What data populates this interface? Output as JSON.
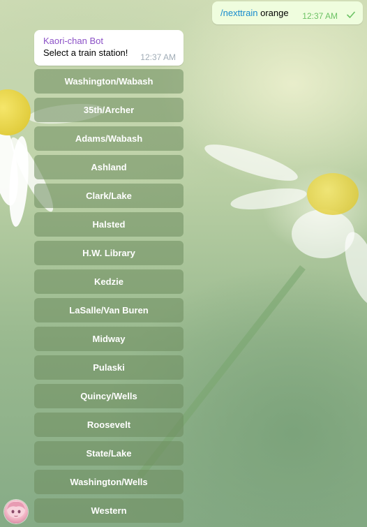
{
  "outgoing_message": {
    "command": "/nexttrain",
    "argument": "orange",
    "time": "12:37 AM",
    "status_icon": "check-icon",
    "status_color": "#6cc264"
  },
  "incoming_message": {
    "sender": "Kaori-chan Bot",
    "text": "Select a train station!",
    "time": "12:37 AM",
    "sender_color": "#8c51c7"
  },
  "keyboard": {
    "buttons": [
      "Washington/Wabash",
      "35th/Archer",
      "Adams/Wabash",
      "Ashland",
      "Clark/Lake",
      "Halsted",
      "H.W. Library",
      "Kedzie",
      "LaSalle/Van Buren",
      "Midway",
      "Pulaski",
      "Quincy/Wells",
      "Roosevelt",
      "State/Lake",
      "Washington/Wells",
      "Western"
    ]
  },
  "avatar": {
    "icon": "bot-avatar"
  }
}
